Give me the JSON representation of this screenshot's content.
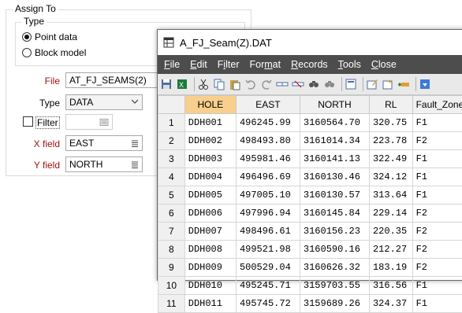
{
  "assign_dialog": {
    "group_title": "Assign To",
    "type_group_title": "Type",
    "radio_point": "Point data",
    "radio_block": "Block model",
    "file_label": "File",
    "file_value": "AT_FJ_SEAMS(2)",
    "type_label": "Type",
    "type_value": "DATA",
    "filter_label": "Filter",
    "filter_value": "",
    "xfield_label": "X field",
    "xfield_value": "EAST",
    "yfield_label": "Y field",
    "yfield_value": "NORTH"
  },
  "data_window": {
    "title": "A_FJ_Seam(Z).DAT",
    "menu": [
      "File",
      "Edit",
      "Filter",
      "Format",
      "Records",
      "Tools",
      "Close"
    ],
    "menu_mnemonics": [
      "F",
      "E",
      "i",
      "m",
      "R",
      "T",
      "C"
    ],
    "columns": [
      "HOLE",
      "EAST",
      "NORTH",
      "RL",
      "Fault_Zone"
    ],
    "rows": [
      [
        "1",
        "DDH001",
        "496245.99",
        "3160564.70",
        "320.75",
        "F1"
      ],
      [
        "2",
        "DDH002",
        "498493.80",
        "3161014.34",
        "223.78",
        "F2"
      ],
      [
        "3",
        "DDH003",
        "495981.46",
        "3160141.13",
        "322.49",
        "F1"
      ],
      [
        "4",
        "DDH004",
        "496496.69",
        "3160130.46",
        "324.12",
        "F1"
      ],
      [
        "5",
        "DDH005",
        "497005.10",
        "3160130.57",
        "313.64",
        "F1"
      ],
      [
        "6",
        "DDH006",
        "497996.94",
        "3160145.84",
        "229.14",
        "F2"
      ],
      [
        "7",
        "DDH007",
        "498496.61",
        "3160156.23",
        "220.35",
        "F2"
      ],
      [
        "8",
        "DDH008",
        "499521.98",
        "3160590.16",
        "212.27",
        "F2"
      ],
      [
        "9",
        "DDH009",
        "500529.04",
        "3160626.32",
        "183.19",
        "F2"
      ],
      [
        "10",
        "DDH010",
        "495245.71",
        "3159703.55",
        "316.56",
        "F1"
      ],
      [
        "11",
        "DDH011",
        "495745.72",
        "3159689.26",
        "324.37",
        "F1"
      ]
    ]
  },
  "colors": {
    "menubar_bg": "#4d4d4d",
    "hole_header_bg": "#f8cf8c",
    "label_red": "#a01010"
  }
}
